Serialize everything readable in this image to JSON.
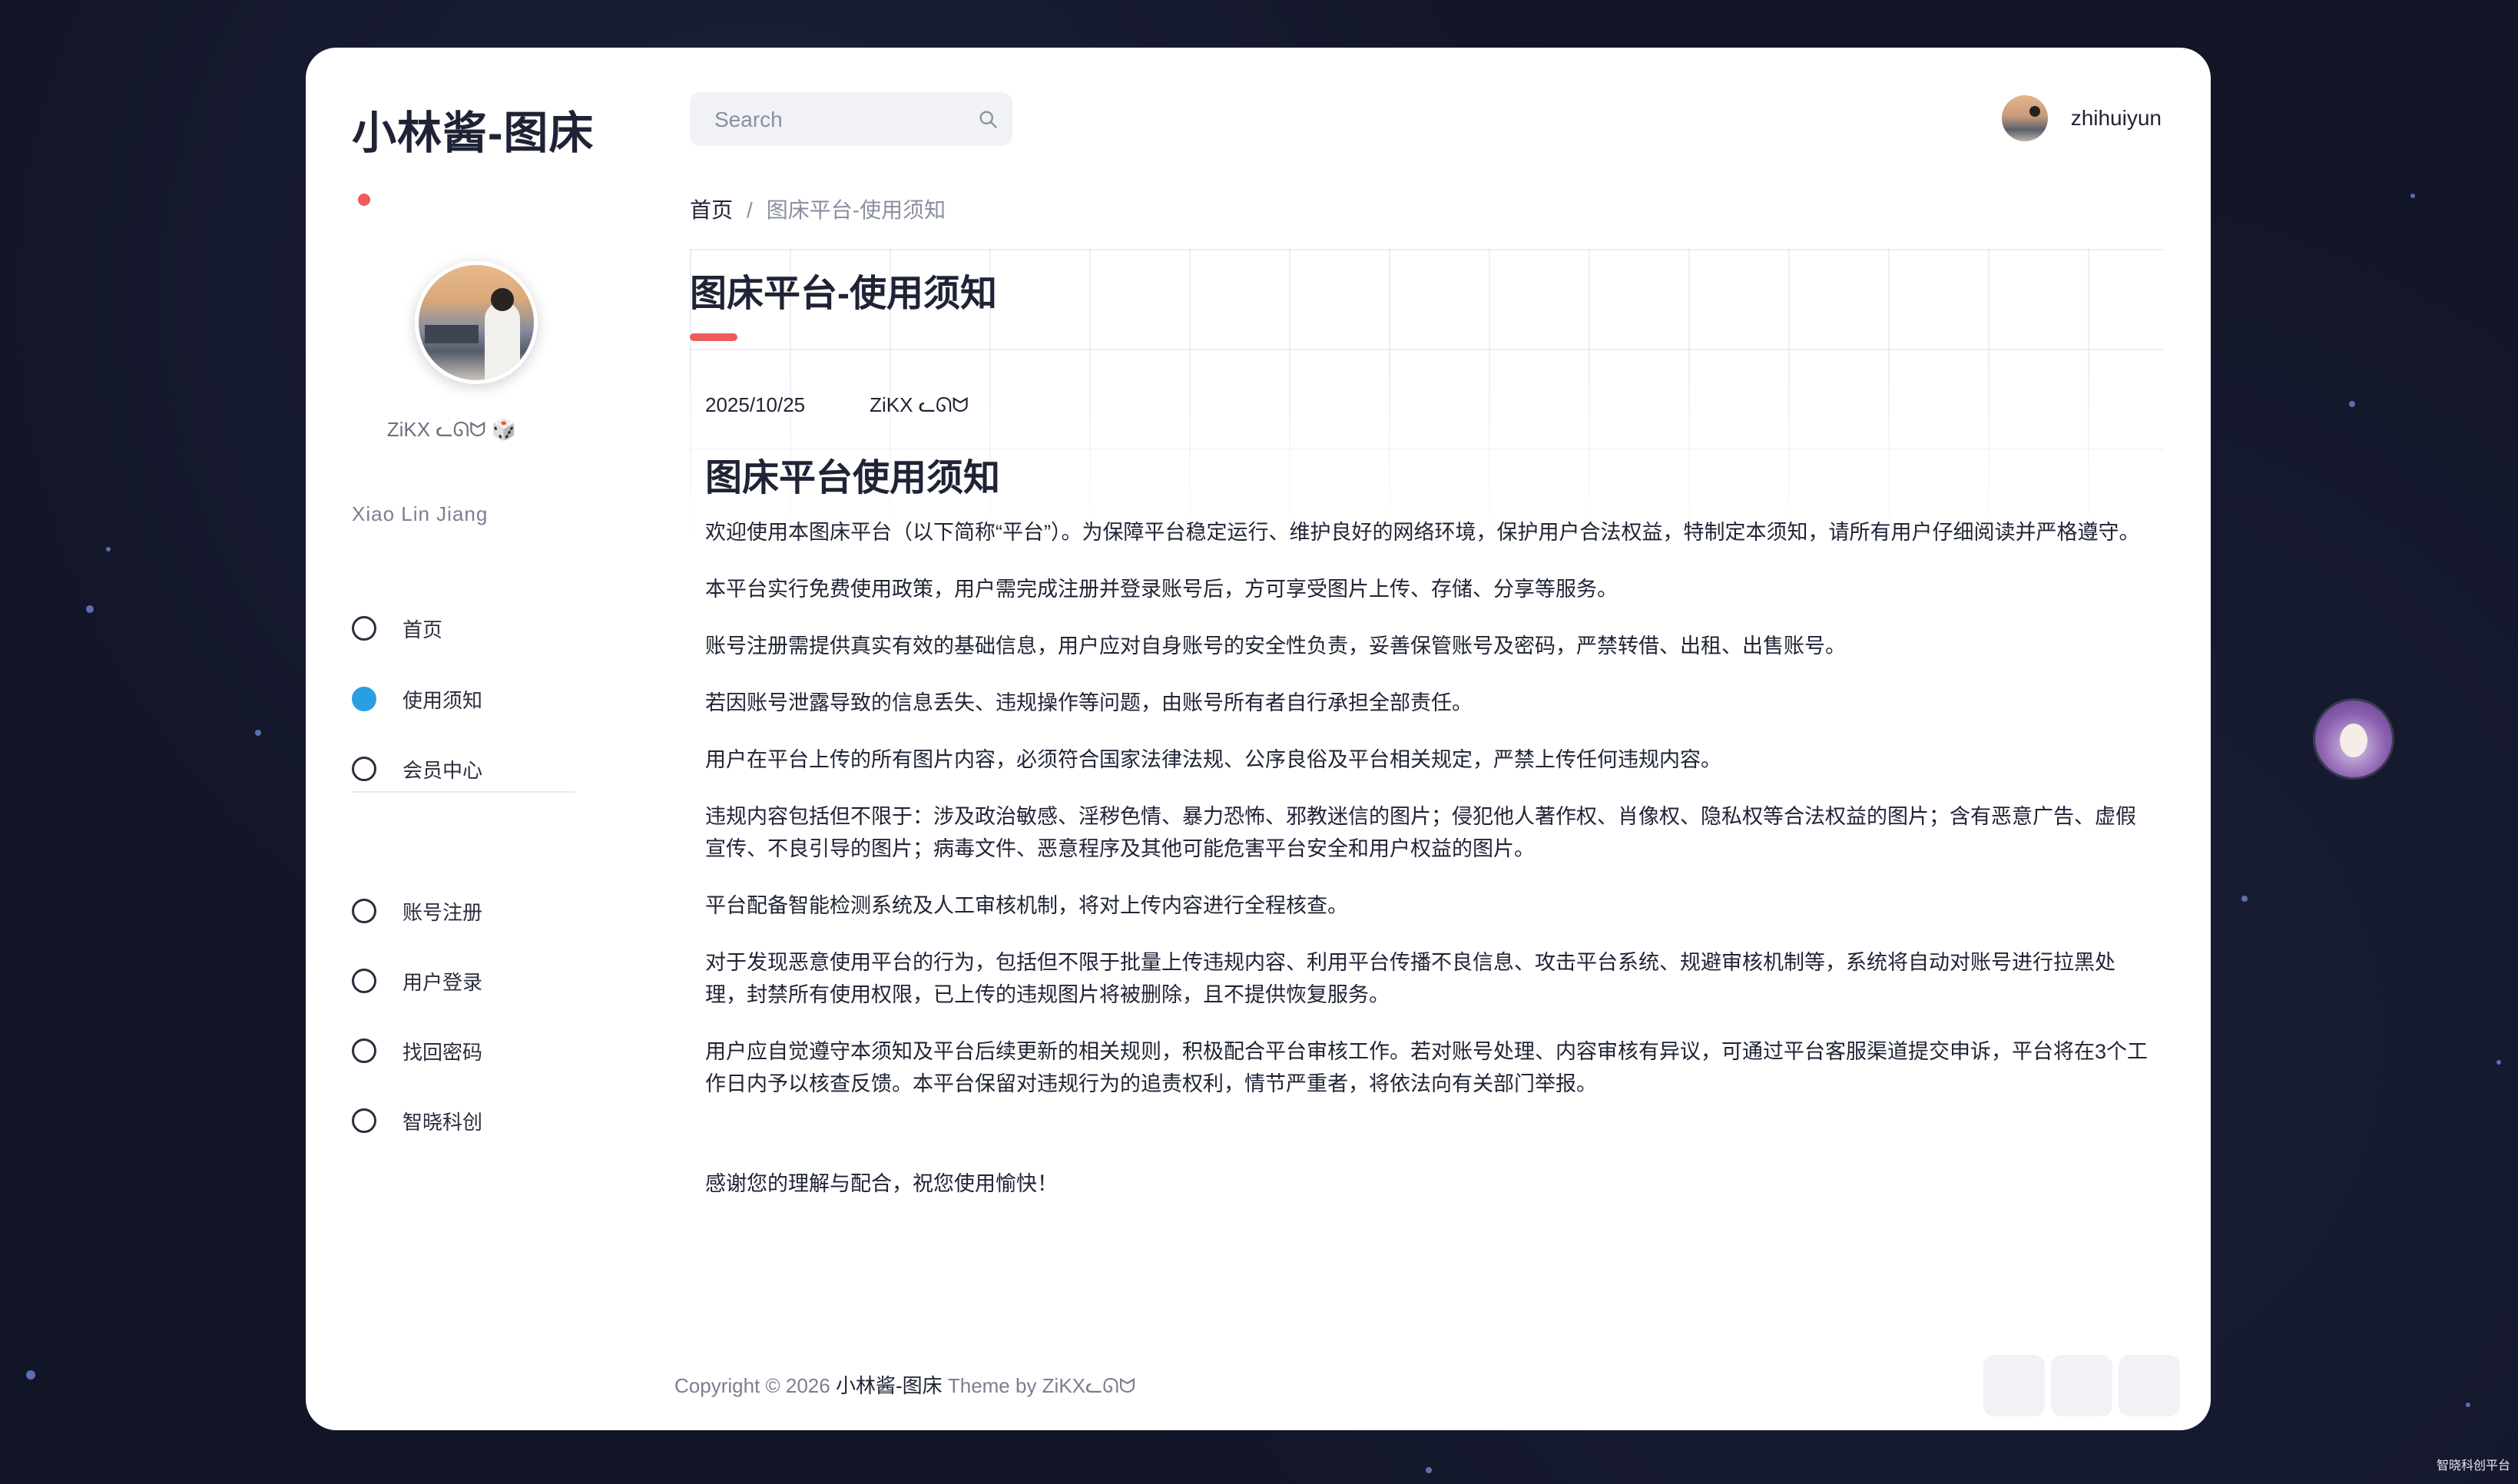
{
  "sidebar": {
    "logo": "小林酱-图床",
    "username": "ZiKX ᓚᘏᗢ 🎲",
    "site_sub": "Xiao Lin Jiang",
    "items": [
      {
        "label": "首页"
      },
      {
        "label": "使用须知"
      },
      {
        "label": "会员中心"
      },
      {
        "label": "账号注册"
      },
      {
        "label": "用户登录"
      },
      {
        "label": "找回密码"
      },
      {
        "label": "智晓科创"
      }
    ]
  },
  "header": {
    "search_placeholder": "Search",
    "user_name": "zhihuiyun"
  },
  "breadcrumb": {
    "home": "首页",
    "sep": "/",
    "current": "图床平台-使用须知"
  },
  "main": {
    "title": "图床平台-使用须知",
    "date": "2025/10/25",
    "author": "ZiKX ᓚᘏᗢ",
    "article_title": "图床平台使用须知",
    "paragraphs": [
      "欢迎使用本图床平台（以下简称“平台”）。为保障平台稳定运行、维护良好的网络环境，保护用户合法权益，特制定本须知，请所有用户仔细阅读并严格遵守。",
      "本平台实行免费使用政策，用户需完成注册并登录账号后，方可享受图片上传、存储、分享等服务。",
      "账号注册需提供真实有效的基础信息，用户应对自身账号的安全性负责，妥善保管账号及密码，严禁转借、出租、出售账号。",
      "若因账号泄露导致的信息丢失、违规操作等问题，由账号所有者自行承担全部责任。",
      "用户在平台上传的所有图片内容，必须符合国家法律法规、公序良俗及平台相关规定，严禁上传任何违规内容。",
      "违规内容包括但不限于：涉及政治敏感、淫秽色情、暴力恐怖、邪教迷信的图片；侵犯他人著作权、肖像权、隐私权等合法权益的图片；含有恶意广告、虚假宣传、不良引导的图片；病毒文件、恶意程序及其他可能危害平台安全和用户权益的图片。",
      "平台配备智能检测系统及人工审核机制，将对上传内容进行全程核查。",
      "对于发现恶意使用平台的行为，包括但不限于批量上传违规内容、利用平台传播不良信息、攻击平台系统、规避审核机制等，系统将自动对账号进行拉黑处理，封禁所有使用权限，已上传的违规图片将被删除，且不提供恢复服务。",
      "用户应自觉遵守本须知及平台后续更新的相关规则，积极配合平台审核工作。若对账号处理、内容审核有异议，可通过平台客服渠道提交申诉，平台将在3个工作日内予以核查反馈。本平台保留对违规行为的追责权利，情节严重者，将依法向有关部门举报。"
    ],
    "closing": "感谢您的理解与配合，祝您使用愉快！"
  },
  "footer": {
    "prefix": "Copyright © 2026 ",
    "brand": "小林酱-图床",
    "suffix": " Theme by ZiKXᓚᘏᗢ"
  },
  "corner_text": "智晓科创平台",
  "colors": {
    "accent_red": "#ef5a5a",
    "accent_blue": "#2b9ee3",
    "background": "#121526"
  }
}
